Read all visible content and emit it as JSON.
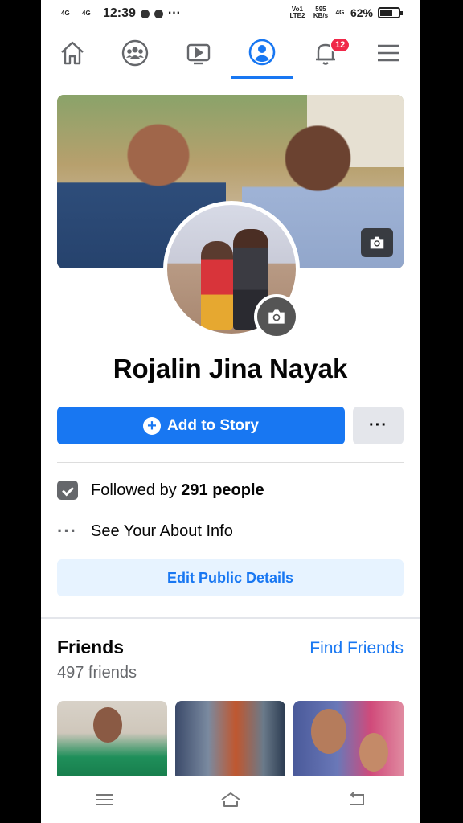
{
  "status_bar": {
    "network_left_1": "4G",
    "network_left_2": "4G",
    "time": "12:39",
    "more_indicator": "···",
    "volte": "Vo1 LTE2",
    "speed": "595 KB/s",
    "network_right": "4G",
    "battery_percent": "62%",
    "battery_level": 0.62
  },
  "nav": {
    "items": [
      {
        "name": "home",
        "icon": "home-icon"
      },
      {
        "name": "groups",
        "icon": "groups-icon"
      },
      {
        "name": "watch",
        "icon": "video-icon"
      },
      {
        "name": "profile",
        "icon": "profile-icon",
        "active": true
      },
      {
        "name": "notifications",
        "icon": "bell-icon",
        "badge": "12"
      },
      {
        "name": "menu",
        "icon": "menu-icon"
      }
    ],
    "accent": "#1877f2"
  },
  "profile": {
    "name": "Rojalin Jina Nayak",
    "add_story_label": "Add to Story",
    "more_label": "···"
  },
  "details": {
    "followed_prefix": "Followed by ",
    "followed_count": "291 people",
    "about_label": "See Your About Info",
    "edit_label": "Edit Public Details"
  },
  "friends": {
    "title": "Friends",
    "find_label": "Find Friends",
    "count_label": "497 friends"
  },
  "system_nav": {
    "icons": [
      "menu-lines-icon",
      "home-outline-icon",
      "back-icon"
    ]
  }
}
